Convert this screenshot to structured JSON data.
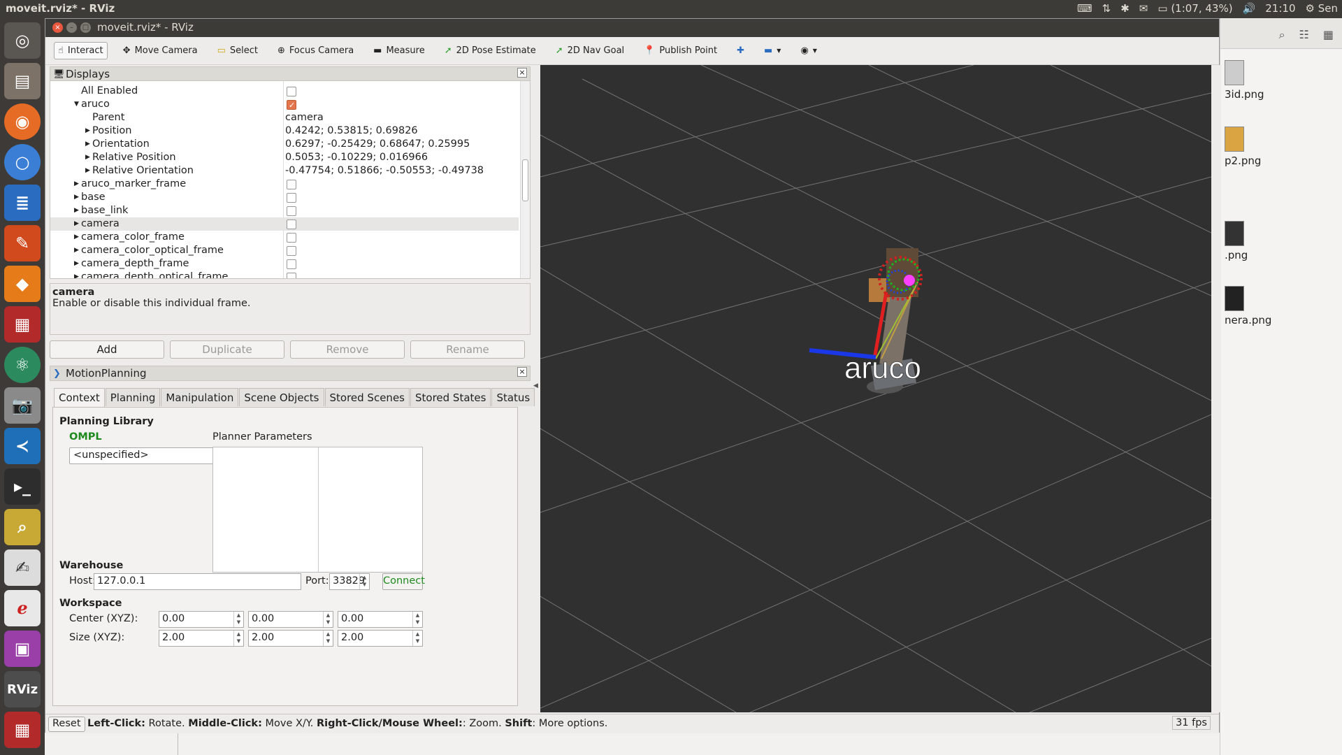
{
  "os": {
    "window_label": "moveit.rviz* - RViz",
    "battery": "(1:07, 43%)",
    "clock": "21:10",
    "user": "Sen"
  },
  "window": {
    "title": "moveit.rviz* - RViz"
  },
  "toolbar": {
    "tools": [
      {
        "label": "Interact",
        "icon": "hand-icon"
      },
      {
        "label": "Move Camera",
        "icon": "move-camera-icon"
      },
      {
        "label": "Select",
        "icon": "select-icon"
      },
      {
        "label": "Focus Camera",
        "icon": "focus-camera-icon"
      },
      {
        "label": "Measure",
        "icon": "measure-icon"
      },
      {
        "label": "2D Pose Estimate",
        "icon": "pose-estimate-icon"
      },
      {
        "label": "2D Nav Goal",
        "icon": "nav-goal-icon"
      },
      {
        "label": "Publish Point",
        "icon": "publish-point-icon"
      }
    ]
  },
  "displays": {
    "title": "Displays",
    "rows": [
      {
        "label": "All Enabled",
        "indent": 0,
        "checkbox": false
      },
      {
        "label": "aruco",
        "indent": 1,
        "expanded": true,
        "checkbox": true
      },
      {
        "label": "Parent",
        "indent": 2,
        "value": "camera"
      },
      {
        "label": "Position",
        "indent": 2,
        "collapsed": true,
        "value": "0.4242; 0.53815; 0.69826"
      },
      {
        "label": "Orientation",
        "indent": 2,
        "collapsed": true,
        "value": "0.6297; -0.25429; 0.68647; 0.25995"
      },
      {
        "label": "Relative Position",
        "indent": 2,
        "collapsed": true,
        "value": "0.5053; -0.10229; 0.016966"
      },
      {
        "label": "Relative Orientation",
        "indent": 2,
        "collapsed": true,
        "value": "-0.47754; 0.51866; -0.50553; -0.49738"
      },
      {
        "label": "aruco_marker_frame",
        "indent": 1,
        "collapsed": true,
        "checkbox": false
      },
      {
        "label": "base",
        "indent": 1,
        "collapsed": true,
        "checkbox": false
      },
      {
        "label": "base_link",
        "indent": 1,
        "collapsed": true,
        "checkbox": false
      },
      {
        "label": "camera",
        "indent": 1,
        "collapsed": true,
        "checkbox": false,
        "selected": true
      },
      {
        "label": "camera_color_frame",
        "indent": 1,
        "collapsed": true,
        "checkbox": false
      },
      {
        "label": "camera_color_optical_frame",
        "indent": 1,
        "collapsed": true,
        "checkbox": false
      },
      {
        "label": "camera_depth_frame",
        "indent": 1,
        "collapsed": true,
        "checkbox": false
      },
      {
        "label": "camera_depth_optical_frame",
        "indent": 1,
        "collapsed": true,
        "checkbox": false
      }
    ]
  },
  "description": {
    "heading": "camera",
    "text": "Enable or disable this individual frame."
  },
  "panel_buttons": {
    "add": "Add",
    "duplicate": "Duplicate",
    "remove": "Remove",
    "rename": "Rename"
  },
  "motion": {
    "title": "MotionPlanning",
    "tabs": [
      "Context",
      "Planning",
      "Manipulation",
      "Scene Objects",
      "Stored Scenes",
      "Stored States",
      "Status"
    ],
    "planning_library": "Planning Library",
    "ompl": "OMPL",
    "planner": "<unspecified>",
    "planner_params": "Planner Parameters",
    "warehouse": "Warehouse",
    "host_label": "Host:",
    "host": "127.0.0.1",
    "port_label": "Port:",
    "port": "33829",
    "connect": "Connect",
    "workspace": "Workspace",
    "center_label": "Center (XYZ):",
    "center": [
      "0.00",
      "0.00",
      "0.00"
    ],
    "size_label": "Size (XYZ):",
    "size": [
      "2.00",
      "2.00",
      "2.00"
    ]
  },
  "view": {
    "marker_label": "aruco"
  },
  "status": {
    "reset": "Reset",
    "k1": "Left-Click:",
    "v1": " Rotate. ",
    "k2": "Middle-Click:",
    "v2": " Move X/Y. ",
    "k3": "Right-Click/Mouse Wheel:",
    "v3": ": Zoom. ",
    "k4": "Shift",
    "v4": ": More options.",
    "fps": "31 fps"
  },
  "desktop_files": [
    "3id.png",
    "p2.png",
    ".png",
    "nera.png"
  ]
}
